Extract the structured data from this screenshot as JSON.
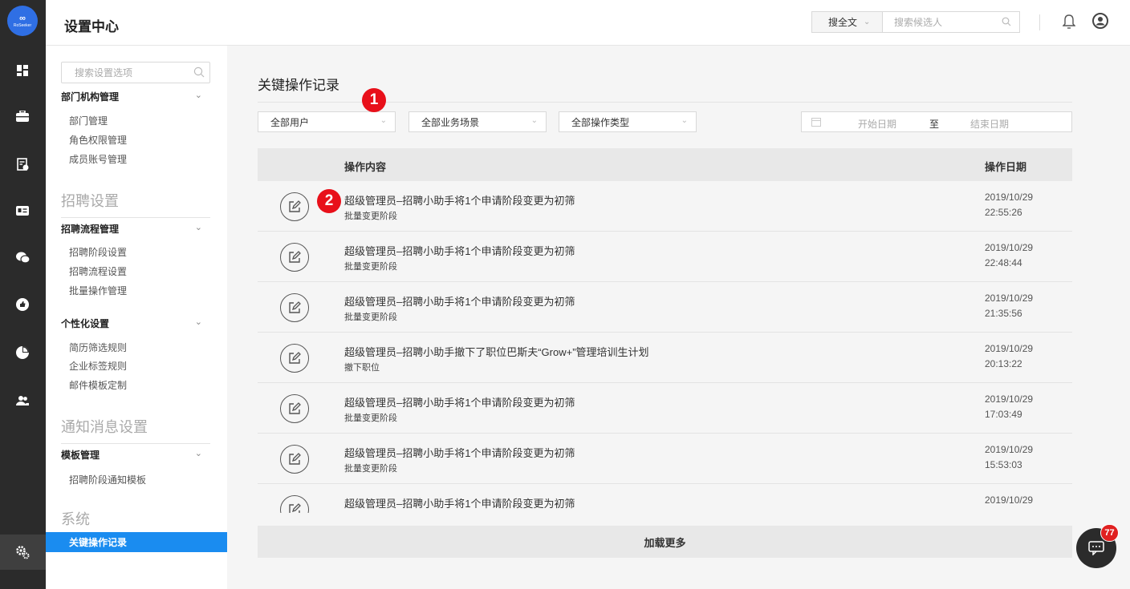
{
  "rail": {
    "logo_text": "∞",
    "logo_sub": "RoSeeker",
    "icons": [
      "dashboard-icon",
      "briefcase-icon",
      "resume-icon",
      "id-card-icon",
      "chat-icon",
      "thumbs-up-icon",
      "pie-chart-icon",
      "people-icon",
      "settings-icon"
    ]
  },
  "header": {
    "title": "设置中心",
    "search_scope": "搜全文",
    "search_placeholder": "搜索候选人"
  },
  "sidebar": {
    "search_placeholder": "搜索设置选项",
    "groups": [
      {
        "label": "部门机构管理",
        "items": [
          "部门管理",
          "角色权限管理",
          "成员账号管理"
        ]
      },
      {
        "label": "招聘流程管理",
        "items": [
          "招聘阶段设置",
          "招聘流程设置",
          "批量操作管理"
        ]
      },
      {
        "label": "个性化设置",
        "items": [
          "简历筛选规则",
          "企业标签规则",
          "邮件模板定制"
        ]
      },
      {
        "label": "模板管理",
        "items": [
          "招聘阶段通知模板"
        ]
      }
    ],
    "sections": [
      "招聘设置",
      "通知消息设置",
      "系统"
    ],
    "active_item": "关键操作记录"
  },
  "main": {
    "title": "关键操作记录",
    "filters": {
      "user": "全部用户",
      "scene": "全部业务场景",
      "op_type": "全部操作类型",
      "date_start": "开始日期",
      "date_to": "至",
      "date_end": "结束日期"
    },
    "badges": [
      "1",
      "2"
    ],
    "table": {
      "col_content": "操作内容",
      "col_date": "操作日期",
      "rows": [
        {
          "title": "超级管理员–招聘小助手将1个申请阶段变更为初筛",
          "sub": "批量变更阶段",
          "date": "2019/10/29",
          "time": "22:55:26"
        },
        {
          "title": "超级管理员–招聘小助手将1个申请阶段变更为初筛",
          "sub": "批量变更阶段",
          "date": "2019/10/29",
          "time": "22:48:44"
        },
        {
          "title": "超级管理员–招聘小助手将1个申请阶段变更为初筛",
          "sub": "批量变更阶段",
          "date": "2019/10/29",
          "time": "21:35:56"
        },
        {
          "title": "超级管理员–招聘小助手撤下了职位巴斯夫“Grow+”管理培训生计划",
          "sub": "撤下职位",
          "date": "2019/10/29",
          "time": "20:13:22"
        },
        {
          "title": "超级管理员–招聘小助手将1个申请阶段变更为初筛",
          "sub": "批量变更阶段",
          "date": "2019/10/29",
          "time": "17:03:49"
        },
        {
          "title": "超级管理员–招聘小助手将1个申请阶段变更为初筛",
          "sub": "批量变更阶段",
          "date": "2019/10/29",
          "time": "15:53:03"
        },
        {
          "title": "超级管理员–招聘小助手将1个申请阶段变更为初筛",
          "sub": "",
          "date": "2019/10/29",
          "time": ""
        }
      ]
    },
    "load_more": "加载更多"
  },
  "chat": {
    "unread": "77"
  },
  "colors": {
    "accent": "#1a8cf0",
    "rail": "#2b2b2b",
    "badge": "#e8101a"
  }
}
